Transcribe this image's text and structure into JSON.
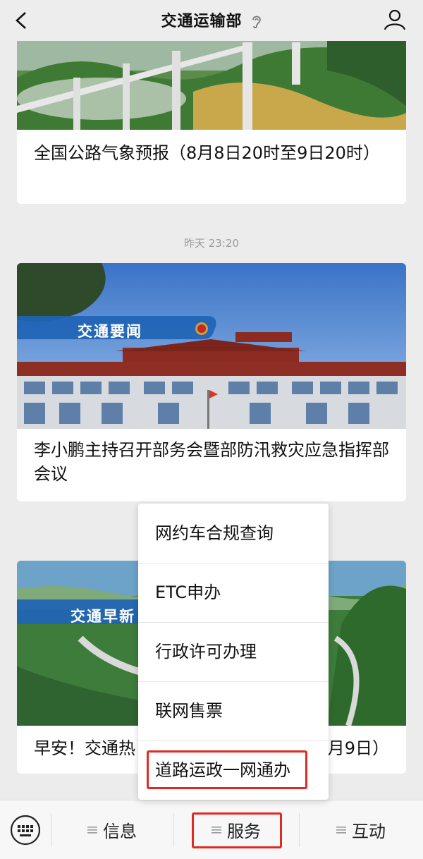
{
  "header": {
    "title": "交通运输部",
    "icons": {
      "back": "chevron-left-icon",
      "ear": "ear-icon",
      "profile": "person-icon"
    }
  },
  "articles": [
    {
      "title": "全国公路气象预报（8月8日20时至9日20时）",
      "image": "highway-bridge-mountains"
    },
    {
      "timestamp": "昨天 23:20",
      "image": "ministry-building",
      "image_banner": "交通要闻",
      "title": "李小鹏主持召开部务会暨部防汛救灾应急指挥部会议"
    },
    {
      "image": "mountain-highway",
      "image_banner": "交通早新",
      "title_left": "早安！交通热",
      "title_right": "月9日）"
    }
  ],
  "menu": {
    "items": [
      "网约车合规查询",
      "ETC申办",
      "行政许可办理",
      "联网售票",
      "道路运政一网通办"
    ],
    "highlighted_index": 4
  },
  "bottom_bar": {
    "keyboard_icon": "keyboard-icon",
    "tabs": [
      "信息",
      "服务",
      "互动"
    ],
    "active_tab_index": 1
  },
  "colors": {
    "highlight": "#e02a24",
    "background": "#ececec",
    "timestamp": "#9a9a9a"
  }
}
